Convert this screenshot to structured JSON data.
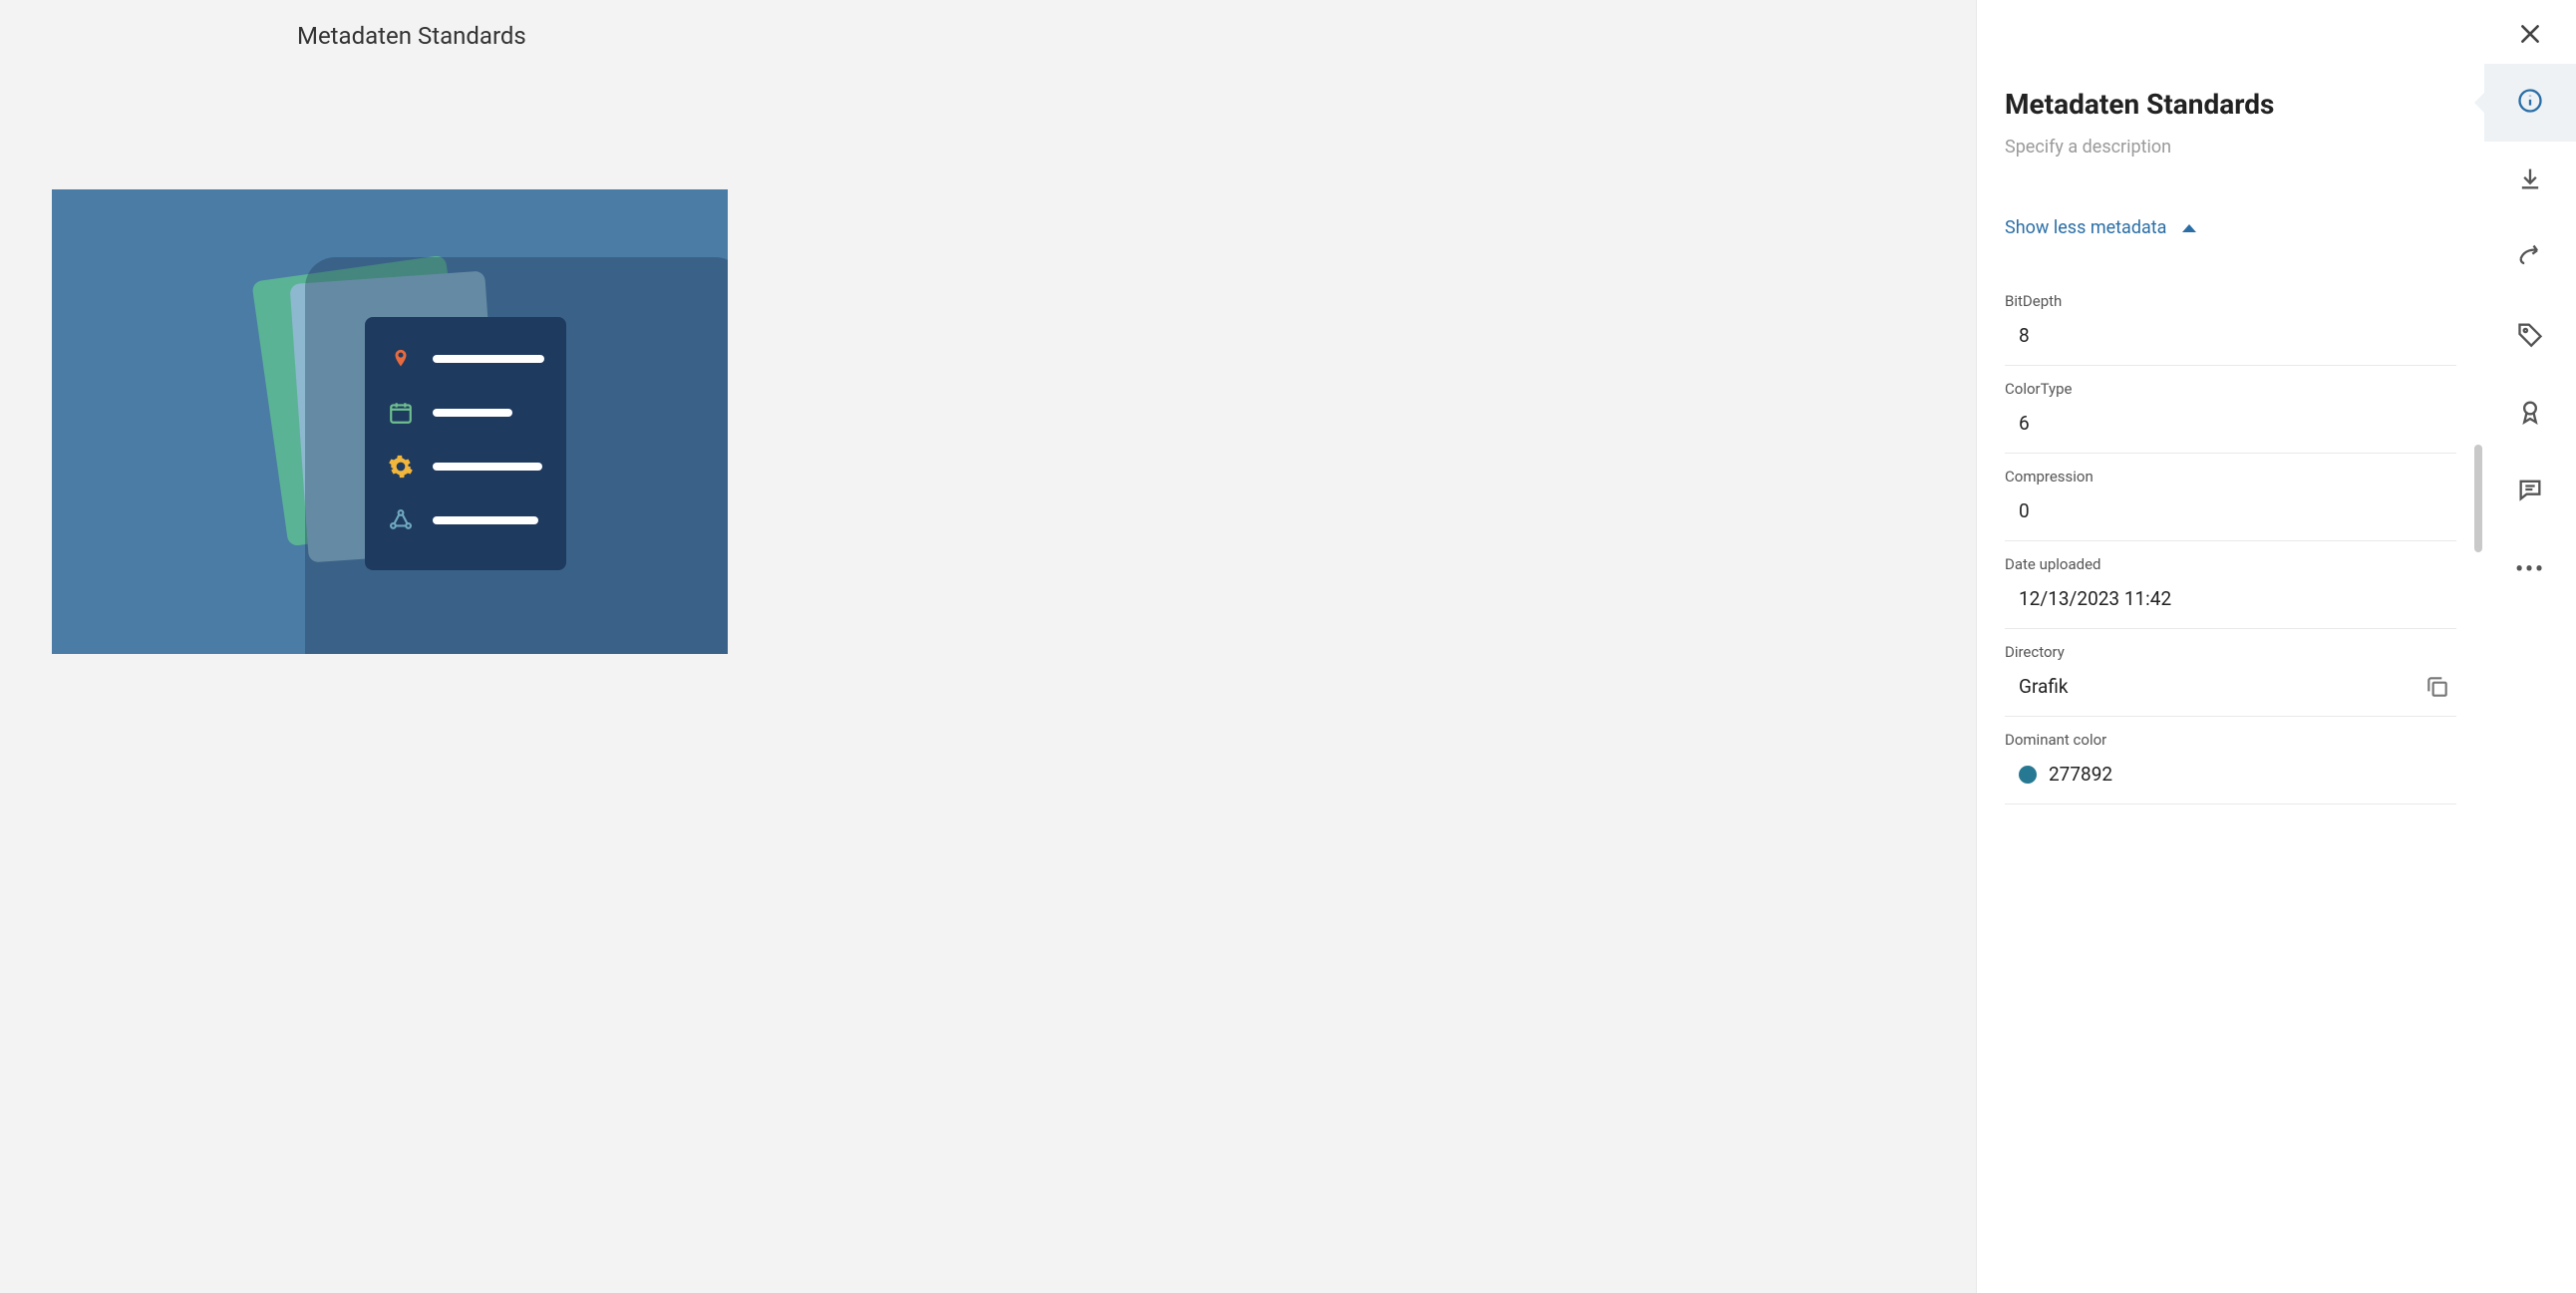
{
  "preview": {
    "title": "Metadaten Standards"
  },
  "detail": {
    "title": "Metadaten Standards",
    "description_placeholder": "Specify a description",
    "toggle_label": "Show less metadata",
    "metadata": [
      {
        "label": "BitDepth",
        "value": "8"
      },
      {
        "label": "ColorType",
        "value": "6"
      },
      {
        "label": "Compression",
        "value": "0"
      },
      {
        "label": "Date uploaded",
        "value": "12/13/2023 11:42"
      },
      {
        "label": "Directory",
        "value": "Grafik",
        "copyable": true
      },
      {
        "label": "Dominant color",
        "value": "277892",
        "swatch": "#277892"
      }
    ]
  },
  "rail": {
    "close": "close",
    "items": [
      {
        "name": "info-icon",
        "active": true
      },
      {
        "name": "download-icon",
        "active": false
      },
      {
        "name": "share-icon",
        "active": false
      },
      {
        "name": "tag-icon",
        "active": false
      },
      {
        "name": "award-icon",
        "active": false
      },
      {
        "name": "comment-icon",
        "active": false
      },
      {
        "name": "more-icon",
        "active": false
      }
    ]
  }
}
